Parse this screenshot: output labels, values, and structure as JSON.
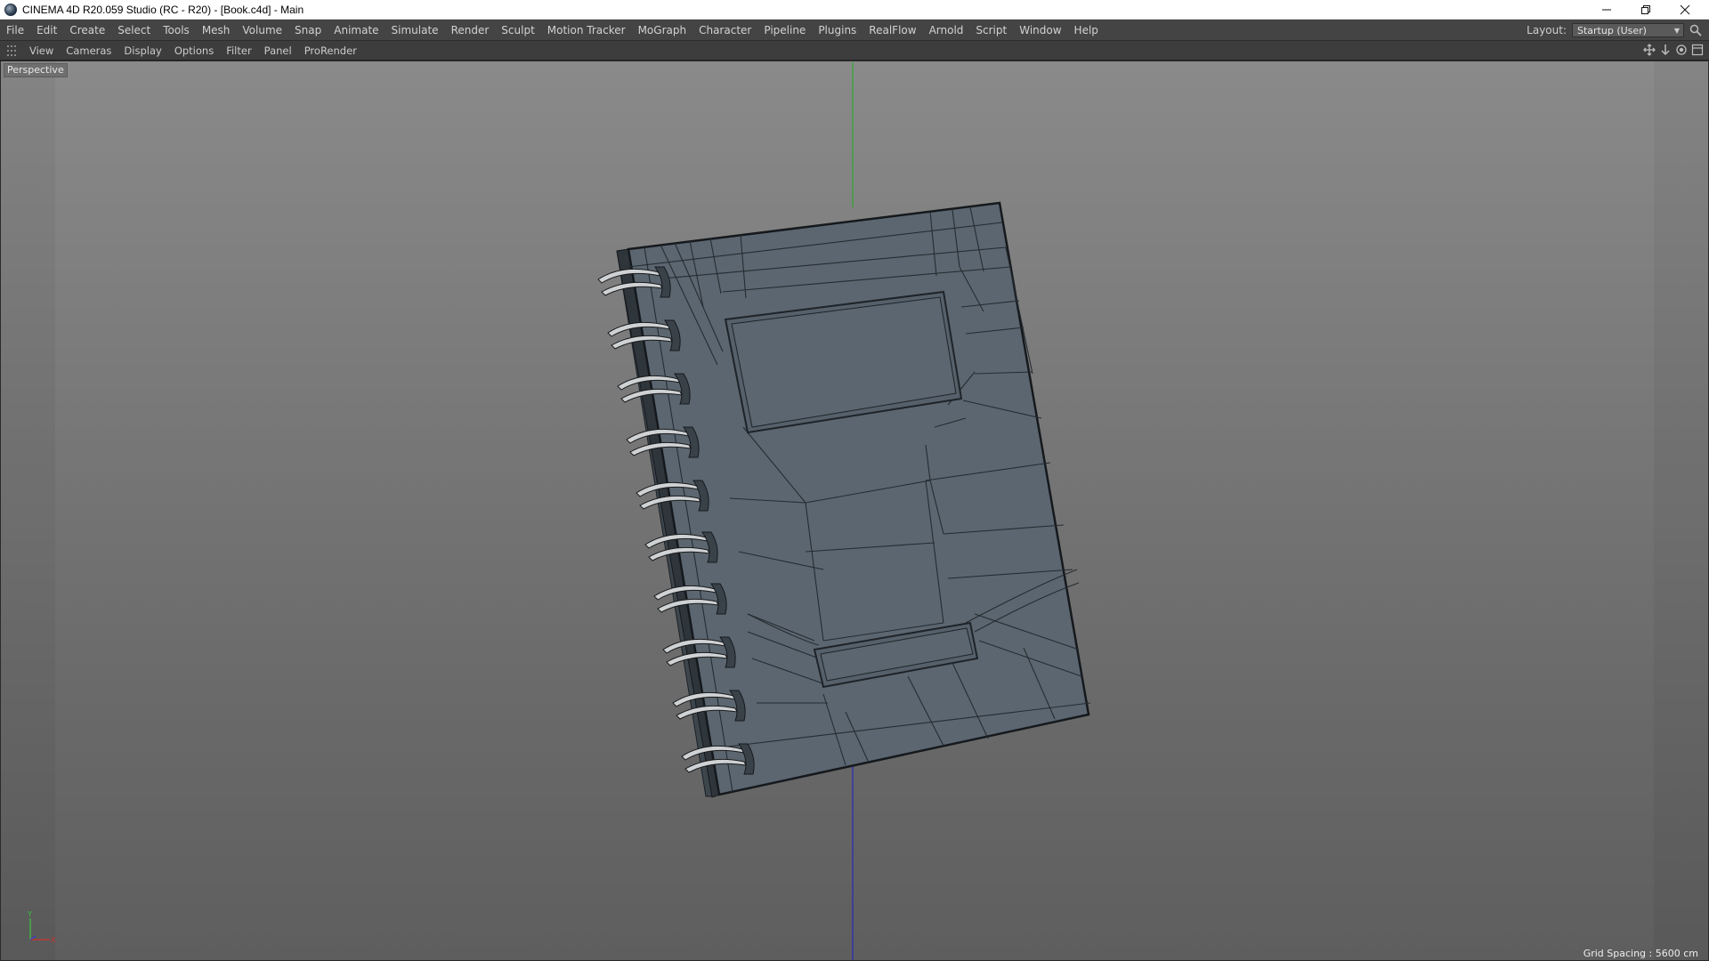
{
  "window": {
    "title": "CINEMA 4D R20.059 Studio (RC - R20) - [Book.c4d] - Main",
    "controls": {
      "minimize_icon": "minimize-icon",
      "maximize_icon": "restore-icon",
      "close_icon": "close-icon"
    }
  },
  "menubar": {
    "items": [
      "File",
      "Edit",
      "Create",
      "Select",
      "Tools",
      "Mesh",
      "Volume",
      "Snap",
      "Animate",
      "Simulate",
      "Render",
      "Sculpt",
      "Motion Tracker",
      "MoGraph",
      "Character",
      "Pipeline",
      "Plugins",
      "RealFlow",
      "Arnold",
      "Script",
      "Window",
      "Help"
    ],
    "layout_label": "Layout:",
    "layout_value": "Startup (User)"
  },
  "viewport_menu": {
    "items": [
      "View",
      "Cameras",
      "Display",
      "Options",
      "Filter",
      "Panel",
      "ProRender"
    ]
  },
  "viewport": {
    "camera_label": "Perspective",
    "grid_spacing": "Grid Spacing : 5600 cm",
    "axis_labels": {
      "y": "Y",
      "x": "X"
    }
  },
  "colors": {
    "y_axis": "#2ea82e",
    "z_axis": "#2a2ab8",
    "model_fill": "#5b6670",
    "wire": "#1e2328"
  }
}
